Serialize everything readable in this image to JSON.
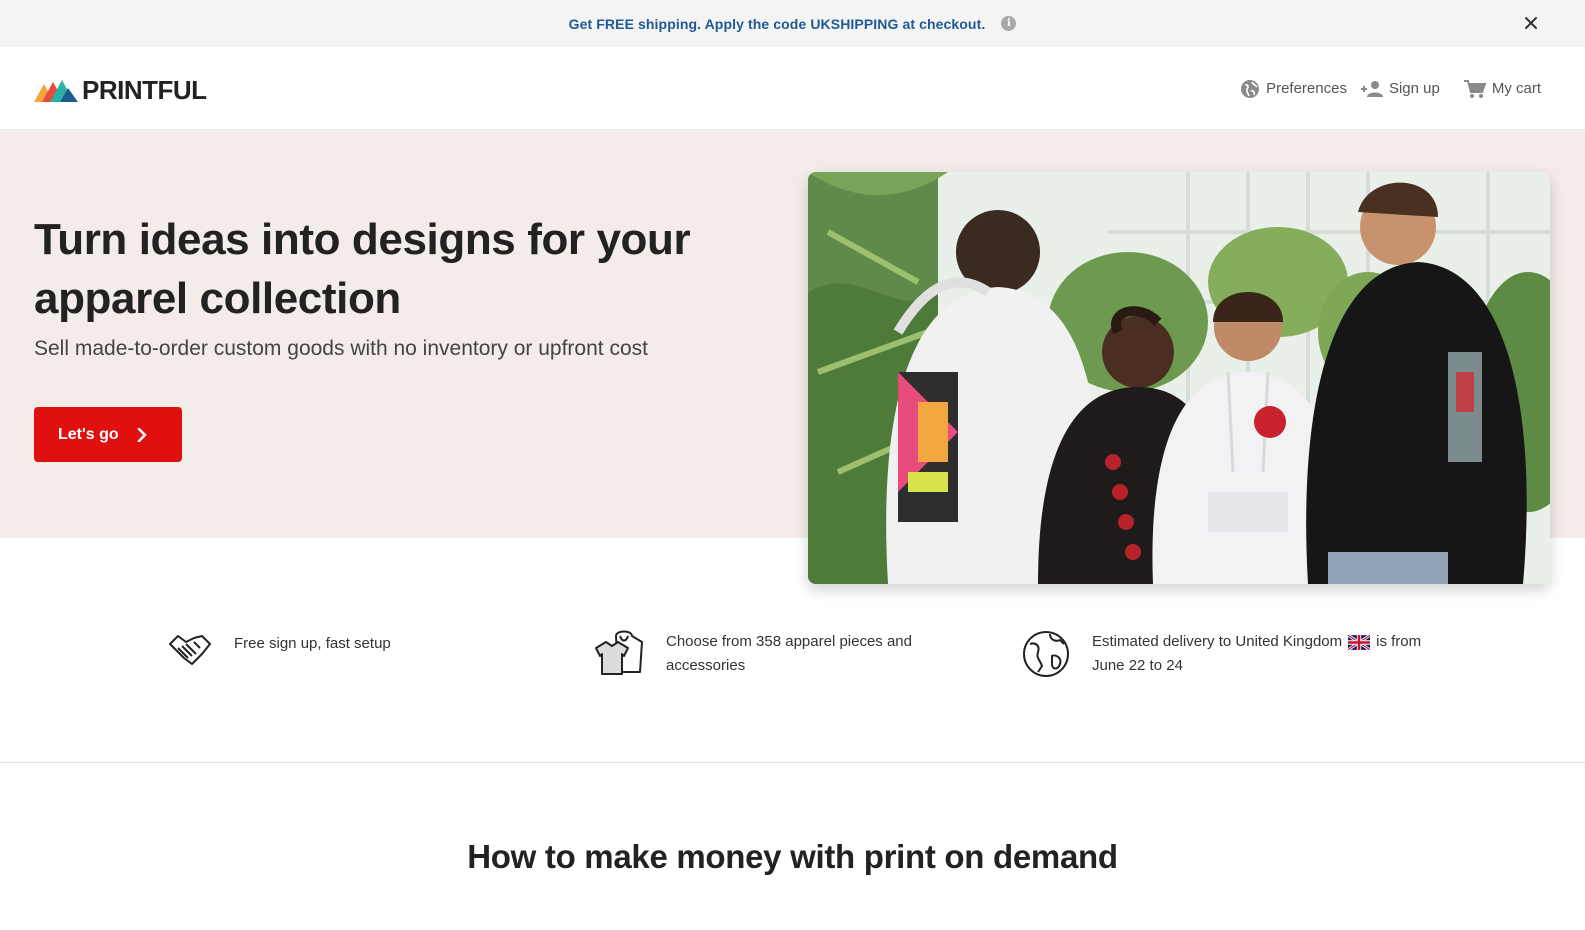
{
  "promo": {
    "text": "Get FREE shipping. Apply the code UKSHIPPING at checkout.",
    "info_glyph": "i"
  },
  "header": {
    "logo_text": "PRINTFUL",
    "nav": {
      "preferences": "Preferences",
      "sign_up": "Sign up",
      "cart": "My cart"
    }
  },
  "hero": {
    "title": "Turn ideas into designs for your apparel collection",
    "subtitle": "Sell made-to-order custom goods with no inventory or upfront cost",
    "cta_label": "Let's go"
  },
  "features": [
    {
      "icon": "handshake-icon",
      "text": "Free sign up, fast setup"
    },
    {
      "icon": "apparel-icon",
      "text": "Choose from 358 apparel pieces and accessories"
    },
    {
      "icon": "globe-icon",
      "text_before": "Estimated delivery to United Kingdom",
      "text_after": "is from June 22 to 24"
    }
  ],
  "section": {
    "title": "How to make money with print on demand"
  },
  "colors": {
    "promo_text": "#1f5a96",
    "cta": "#e0100f",
    "hero_bg": "#f3ece9"
  }
}
